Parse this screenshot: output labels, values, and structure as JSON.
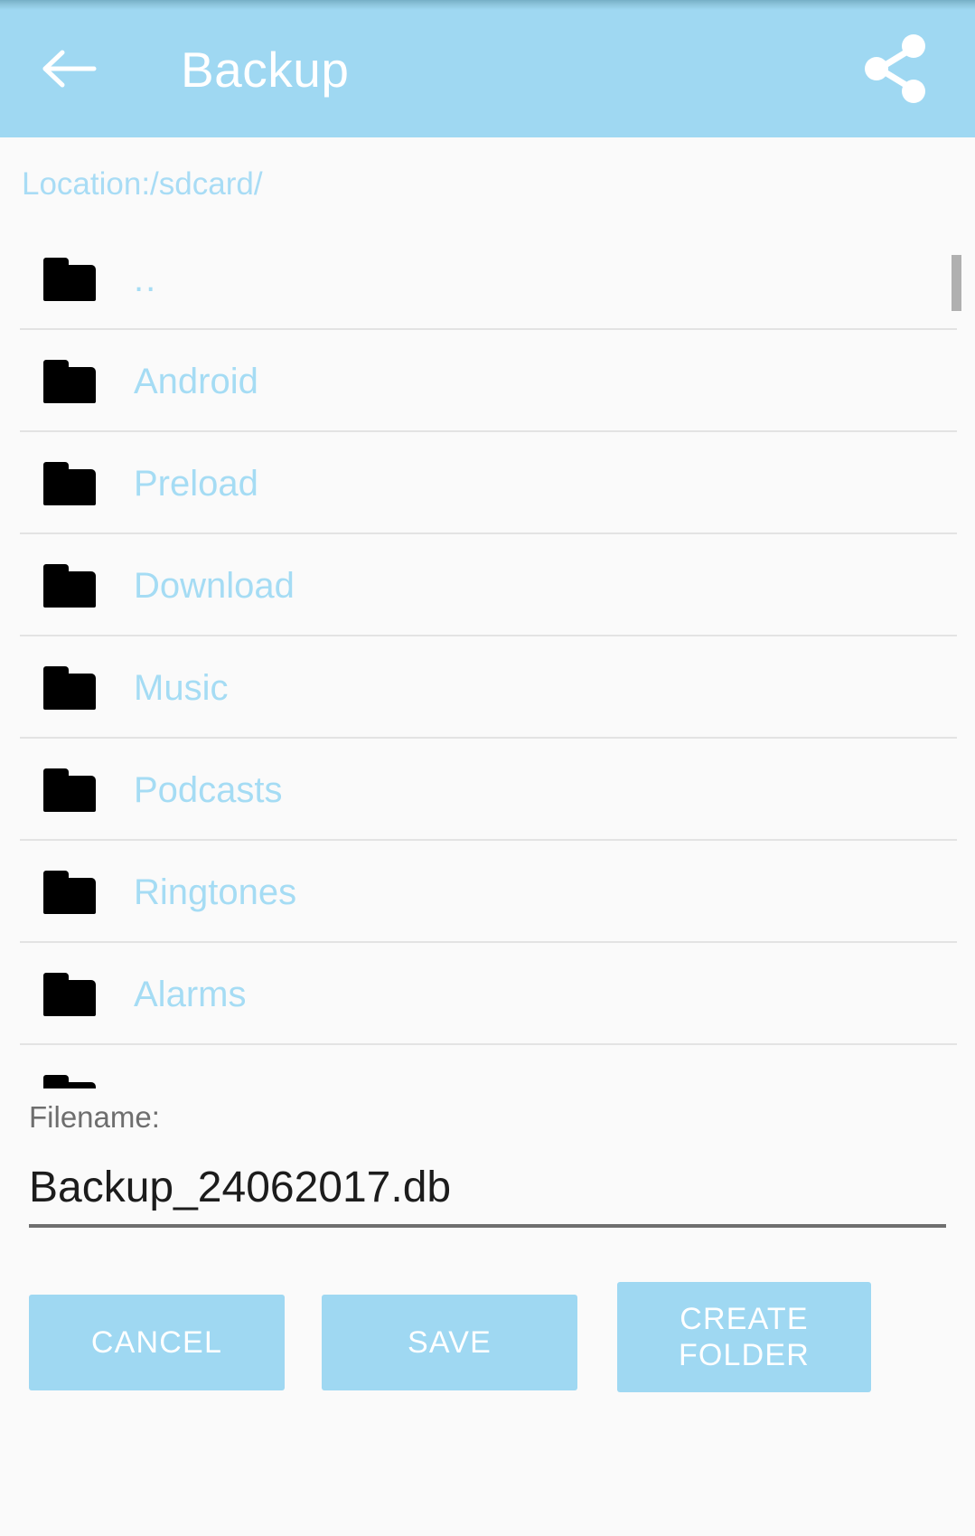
{
  "appbar": {
    "title": "Backup",
    "back_icon": "arrow-left-icon",
    "share_icon": "share-icon",
    "background_color": "#9fd8f2"
  },
  "location": {
    "text": "Location:/sdcard/",
    "color": "#a8dcf5"
  },
  "file_list": {
    "accent_color": "#a5dcf4",
    "items": [
      {
        "name": "..",
        "icon": "folder-icon"
      },
      {
        "name": "Android",
        "icon": "folder-icon"
      },
      {
        "name": "Preload",
        "icon": "folder-icon"
      },
      {
        "name": "Download",
        "icon": "folder-icon"
      },
      {
        "name": "Music",
        "icon": "folder-icon"
      },
      {
        "name": "Podcasts",
        "icon": "folder-icon"
      },
      {
        "name": "Ringtones",
        "icon": "folder-icon"
      },
      {
        "name": "Alarms",
        "icon": "folder-icon"
      },
      {
        "name": "",
        "icon": "folder-icon"
      }
    ]
  },
  "filename": {
    "label": "Filename:",
    "value": "Backup_24062017.db",
    "placeholder": "Filename"
  },
  "buttons": {
    "cancel": "CANCEL",
    "save": "SAVE",
    "create_folder": "CREATE\nFOLDER",
    "create_folder_line1": "CREATE",
    "create_folder_line2": "FOLDER",
    "color": "#9fd8f2"
  }
}
